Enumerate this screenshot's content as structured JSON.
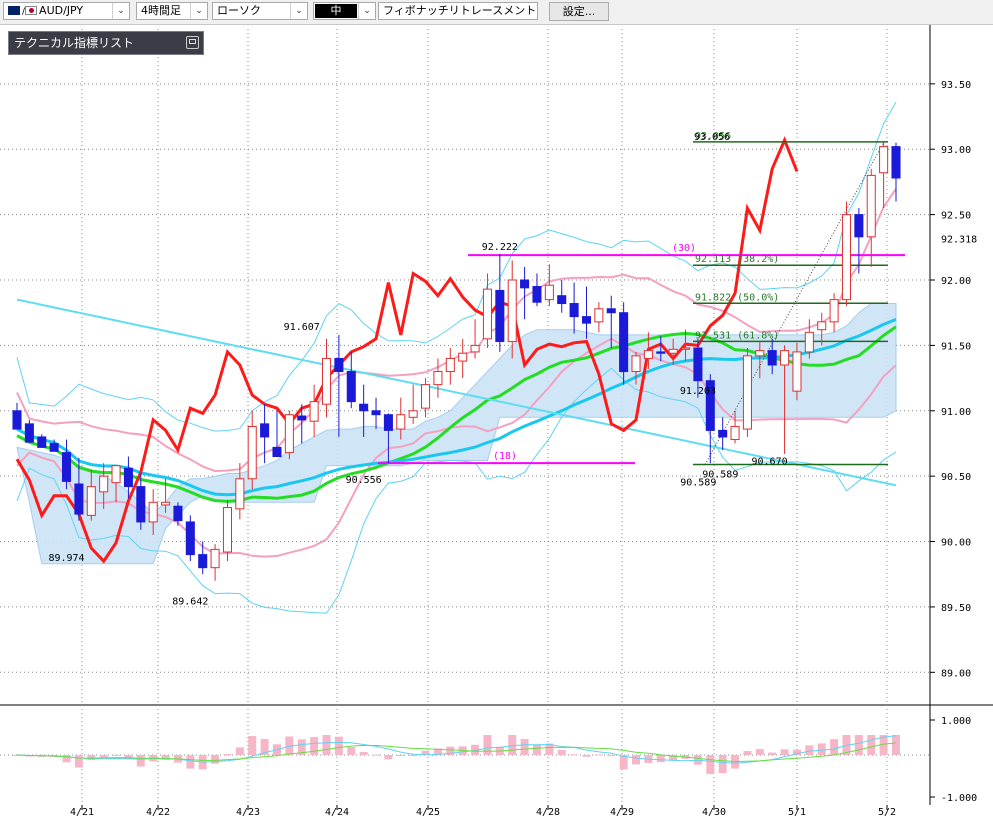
{
  "toolbar": {
    "symbol": "AUD/JPY",
    "timeframe": "4時間足",
    "chart_type": "ローソク",
    "line_width": "中",
    "drawing_tool": "フィボナッチリトレースメント",
    "settings_label": "設定..."
  },
  "indicator_panel": {
    "title": "テクニカル指標リスト"
  },
  "chart_data": {
    "type": "candlestick",
    "y_axis": {
      "ticks": [
        "93.50",
        "93.00",
        "92.50",
        "92.00",
        "91.50",
        "91.00",
        "90.50",
        "90.00",
        "89.50",
        "89.00"
      ],
      "ylim": [
        88.75,
        93.95
      ],
      "current_price": "92.318"
    },
    "x_axis": {
      "ticks": [
        "4/21",
        "4/22",
        "4/23",
        "4/24",
        "4/25",
        "4/28",
        "4/29",
        "4/30",
        "5/1",
        "5/2"
      ]
    },
    "oscillator": {
      "ticks": [
        "1.000",
        "-1.000"
      ]
    },
    "price_annotations": [
      "89.974",
      "89.642",
      "91.607",
      "90.556",
      "92.222",
      "91.203",
      "90.589",
      "90.589",
      "90.670",
      "93.056"
    ],
    "fibonacci": {
      "levels": [
        {
          "label": "93.056",
          "value": 93.056
        },
        {
          "label": "92.113 (38.2%)",
          "value": 92.113
        },
        {
          "label": "91.822 (50.0%)",
          "value": 91.822
        },
        {
          "label": "91.531 (61.8%)",
          "value": 91.531
        },
        {
          "label": "",
          "value": 90.589
        }
      ]
    },
    "hlines": [
      {
        "label": "(30)",
        "value": 92.19,
        "color": "#ff00ff"
      },
      {
        "label": "(18)",
        "value": 90.6,
        "color": "#ff00ff"
      }
    ],
    "candles": [
      [
        91.0,
        91.06,
        90.95,
        90.86
      ],
      [
        90.9,
        90.93,
        90.83,
        90.76
      ],
      [
        90.8,
        90.82,
        90.77,
        90.72
      ],
      [
        90.75,
        90.78,
        90.72,
        90.69
      ],
      [
        90.68,
        90.78,
        90.4,
        90.46
      ],
      [
        90.44,
        90.64,
        90.16,
        90.21
      ],
      [
        90.2,
        90.55,
        90.16,
        90.42
      ],
      [
        90.38,
        90.6,
        90.25,
        90.5
      ],
      [
        90.45,
        90.58,
        90.3,
        90.58
      ],
      [
        90.56,
        90.65,
        90.33,
        90.42
      ],
      [
        90.42,
        90.52,
        90.09,
        90.15
      ],
      [
        90.15,
        90.4,
        90.05,
        90.3
      ],
      [
        90.28,
        90.48,
        90.22,
        90.3
      ],
      [
        90.27,
        90.3,
        90.12,
        90.16
      ],
      [
        90.15,
        90.2,
        89.85,
        89.9
      ],
      [
        89.9,
        90.0,
        89.75,
        89.8
      ],
      [
        89.8,
        89.98,
        89.7,
        89.94
      ],
      [
        89.92,
        90.32,
        89.85,
        90.26
      ],
      [
        90.25,
        90.6,
        90.17,
        90.48
      ],
      [
        90.48,
        91.0,
        90.4,
        90.88
      ],
      [
        90.9,
        91.05,
        90.6,
        90.8
      ],
      [
        90.72,
        91.0,
        90.65,
        90.65
      ],
      [
        90.68,
        91.0,
        90.63,
        90.97
      ],
      [
        90.96,
        91.05,
        90.75,
        90.93
      ],
      [
        90.92,
        91.2,
        90.8,
        91.07
      ],
      [
        91.05,
        91.55,
        90.95,
        91.4
      ],
      [
        91.4,
        91.58,
        90.8,
        91.3
      ],
      [
        91.3,
        91.45,
        91.02,
        91.07
      ],
      [
        91.05,
        91.2,
        90.8,
        91.0
      ],
      [
        91.0,
        91.1,
        90.86,
        90.97
      ],
      [
        90.97,
        90.98,
        90.6,
        90.85
      ],
      [
        90.86,
        91.1,
        90.78,
        90.97
      ],
      [
        90.95,
        91.2,
        90.9,
        91.0
      ],
      [
        91.02,
        91.25,
        90.95,
        91.2
      ],
      [
        91.2,
        91.4,
        91.1,
        91.3
      ],
      [
        91.3,
        91.48,
        91.2,
        91.4
      ],
      [
        91.38,
        91.55,
        91.25,
        91.44
      ],
      [
        91.45,
        91.7,
        91.4,
        91.5
      ],
      [
        91.55,
        92.05,
        91.48,
        91.93
      ],
      [
        91.92,
        92.2,
        91.45,
        91.53
      ],
      [
        91.53,
        92.15,
        91.4,
        92.0
      ],
      [
        92.0,
        92.1,
        91.7,
        91.94
      ],
      [
        91.95,
        92.05,
        91.8,
        91.83
      ],
      [
        91.85,
        92.12,
        91.8,
        91.96
      ],
      [
        91.88,
        92.0,
        91.75,
        91.82
      ],
      [
        91.82,
        91.98,
        91.59,
        91.72
      ],
      [
        91.72,
        91.95,
        91.55,
        91.67
      ],
      [
        91.68,
        91.83,
        91.6,
        91.78
      ],
      [
        91.78,
        91.88,
        91.48,
        91.75
      ],
      [
        91.75,
        91.83,
        91.2,
        91.3
      ],
      [
        91.3,
        91.45,
        91.2,
        91.42
      ],
      [
        91.4,
        91.6,
        91.32,
        91.46
      ],
      [
        91.45,
        91.57,
        91.38,
        91.44
      ],
      [
        91.44,
        91.55,
        91.35,
        91.47
      ],
      [
        91.47,
        91.62,
        91.38,
        91.48
      ],
      [
        91.48,
        91.55,
        91.1,
        91.23
      ],
      [
        91.23,
        91.28,
        90.6,
        90.85
      ],
      [
        90.85,
        90.95,
        90.7,
        90.8
      ],
      [
        90.78,
        91.0,
        90.75,
        90.88
      ],
      [
        90.86,
        91.48,
        90.8,
        91.42
      ],
      [
        91.42,
        91.53,
        91.25,
        91.46
      ],
      [
        91.46,
        91.55,
        91.28,
        91.35
      ],
      [
        91.35,
        91.5,
        90.67,
        91.46
      ],
      [
        91.15,
        91.52,
        91.08,
        91.45
      ],
      [
        91.45,
        91.7,
        91.4,
        91.6
      ],
      [
        91.62,
        91.75,
        91.5,
        91.68
      ],
      [
        91.68,
        91.9,
        91.6,
        91.85
      ],
      [
        91.85,
        92.6,
        91.8,
        92.5
      ],
      [
        92.5,
        92.55,
        92.05,
        92.33
      ],
      [
        92.33,
        92.85,
        92.1,
        92.8
      ],
      [
        92.82,
        93.06,
        92.55,
        93.02
      ],
      [
        93.02,
        93.05,
        92.6,
        92.78
      ]
    ],
    "ichimoku_cloud": {
      "upper": [
        90.72,
        90.7,
        90.68,
        90.66,
        90.63,
        90.58,
        90.55,
        90.5,
        90.45,
        90.38,
        90.3,
        90.22,
        90.3,
        90.42,
        90.48,
        90.48,
        90.5,
        90.52,
        90.52,
        90.55,
        90.58,
        90.62,
        90.7,
        90.75,
        90.8,
        90.85,
        90.86,
        90.86,
        90.88,
        90.88,
        90.86,
        90.86,
        90.86,
        90.92,
        90.95,
        91.0,
        91.1,
        91.2,
        91.3,
        91.4,
        91.5,
        91.58,
        91.62,
        91.62,
        91.62,
        91.62,
        91.6,
        91.58,
        91.58,
        91.58,
        91.58,
        91.58,
        91.58,
        91.58,
        91.58,
        91.58,
        91.58,
        91.58,
        91.58,
        91.58,
        91.58,
        91.58,
        91.58,
        91.58,
        91.58,
        91.58,
        91.6,
        91.65,
        91.75,
        91.82,
        91.82,
        91.82
      ],
      "lower": [
        90.72,
        90.3,
        89.83,
        89.83,
        89.83,
        89.83,
        89.83,
        89.83,
        89.83,
        89.83,
        89.83,
        89.83,
        90.1,
        90.2,
        90.3,
        90.35,
        90.32,
        90.3,
        90.3,
        90.3,
        90.3,
        90.3,
        90.3,
        90.3,
        90.3,
        90.58,
        90.58,
        90.58,
        90.58,
        90.58,
        90.58,
        90.58,
        90.6,
        90.62,
        90.62,
        90.62,
        90.62,
        90.62,
        90.62,
        90.95,
        90.95,
        90.95,
        90.95,
        90.95,
        90.95,
        90.95,
        90.95,
        90.95,
        90.95,
        90.95,
        90.95,
        90.95,
        90.95,
        90.95,
        90.95,
        90.95,
        90.95,
        90.95,
        90.95,
        90.95,
        90.95,
        90.95,
        90.95,
        90.95,
        90.95,
        90.95,
        90.95,
        90.95,
        90.95,
        90.95,
        90.95,
        91.0
      ]
    }
  }
}
